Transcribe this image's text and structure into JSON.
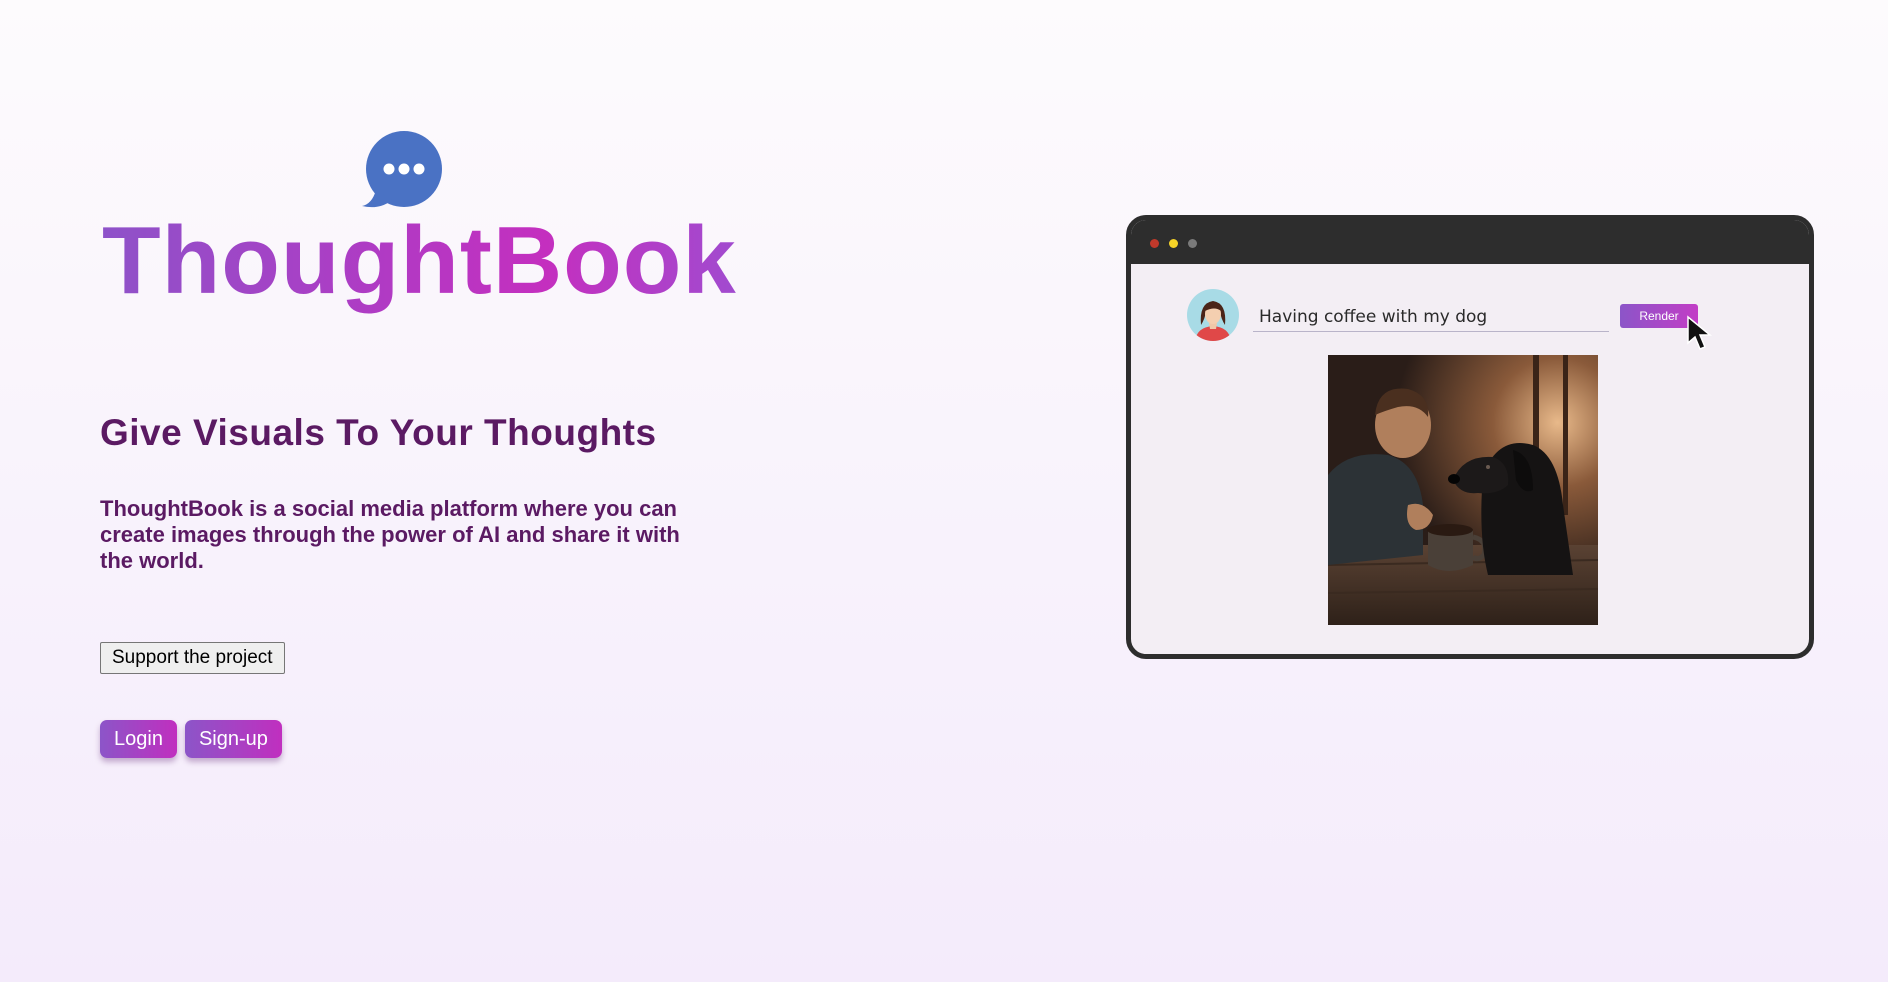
{
  "brand": {
    "name": "ThoughtBook",
    "logo_icon": "speech-bubble-ellipsis-icon",
    "logo_color": "#4a72c4"
  },
  "hero": {
    "tagline": "Give Visuals To Your Thoughts",
    "description": "ThoughtBook is a social media platform where you can create images through the power of AI and share it with the world."
  },
  "actions": {
    "support_label": "Support the project",
    "login_label": "Login",
    "signup_label": "Sign-up"
  },
  "mockup": {
    "prompt_value": "Having coffee with my dog",
    "render_label": "Render",
    "window_dots": [
      "#c0392b",
      "#f5d327",
      "#7a7a7a"
    ],
    "image_subject": "generated-image-man-with-dog-and-coffee"
  },
  "colors": {
    "accent_start": "#8c55c8",
    "accent_end": "#c02fbf",
    "text_dark_purple": "#5b1a63"
  }
}
